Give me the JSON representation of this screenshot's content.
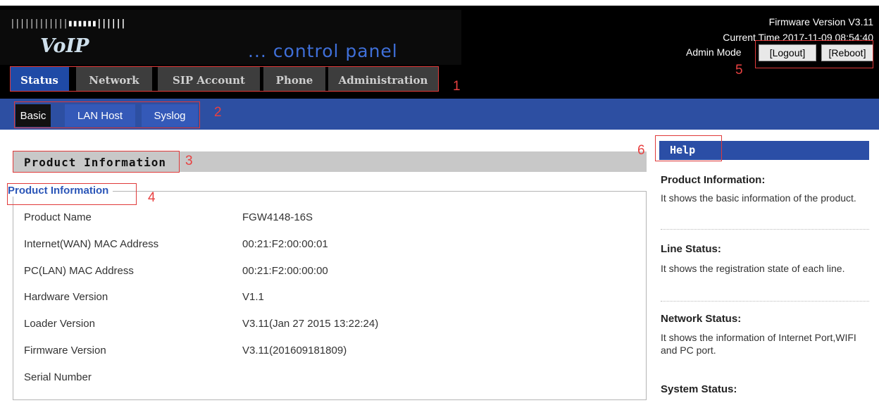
{
  "header": {
    "logo_dots_left": "||||||||||||",
    "logo_dots_right": "▮▮▮▮▮▮||||||",
    "brand": "VoIP",
    "tagline": "... control panel",
    "firmware_version": "Firmware Version V3.11",
    "current_time": "Current Time 2017-11-09 08:54:40",
    "admin_mode": "Admin Mode",
    "logout_label": "[Logout]",
    "reboot_label": "[Reboot]"
  },
  "tabs": [
    {
      "label": "Status",
      "active": true
    },
    {
      "label": "Network",
      "active": false
    },
    {
      "label": "SIP Account",
      "active": false
    },
    {
      "label": "Phone",
      "active": false
    },
    {
      "label": "Administration",
      "active": false
    }
  ],
  "subtabs": [
    {
      "label": "Basic",
      "active": true
    },
    {
      "label": "LAN Host",
      "active": false
    },
    {
      "label": "Syslog",
      "active": false
    }
  ],
  "section": {
    "title": "Product Information",
    "legend": "Product Information",
    "rows": [
      {
        "label": "Product Name",
        "value": "FGW4148-16S"
      },
      {
        "label": "Internet(WAN) MAC Address",
        "value": "00:21:F2:00:00:01"
      },
      {
        "label": "PC(LAN) MAC Address",
        "value": "00:21:F2:00:00:00"
      },
      {
        "label": "Hardware Version",
        "value": "V1.1"
      },
      {
        "label": "Loader Version",
        "value": "V3.11(Jan 27 2015 13:22:24)"
      },
      {
        "label": "Firmware Version",
        "value": "V3.11(201609181809)"
      },
      {
        "label": "Serial Number",
        "value": ""
      }
    ]
  },
  "help": {
    "title": "Help",
    "items": [
      {
        "title": "Product Information:",
        "text": "It shows the basic information of the product."
      },
      {
        "title": "Line Status:",
        "text": "It shows the registration state of each line."
      },
      {
        "title": "Network Status:",
        "text": "It shows the information of Internet Port,WIFI and PC port."
      },
      {
        "title": "System Status:",
        "text": ""
      }
    ]
  },
  "annotations": [
    "1",
    "2",
    "3",
    "4",
    "5",
    "6"
  ],
  "colors": {
    "header_bg": "#000000",
    "tab_active": "#1f4aa6",
    "tab_inactive": "#3d3d3d",
    "subbar": "#2d4fa2",
    "annotation_red": "#e03a3a",
    "legend_blue": "#2b56b8"
  }
}
